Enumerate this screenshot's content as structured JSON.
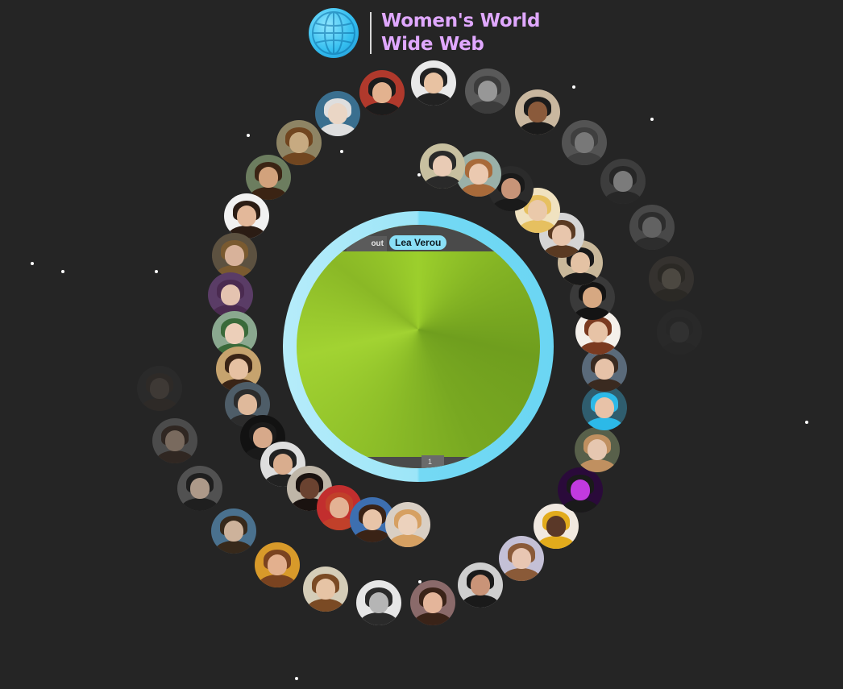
{
  "logo": {
    "title_line1": "Women's World",
    "title_line2": "Wide Web",
    "icon": "globe-icon",
    "colors": {
      "globe": "#35bff0",
      "title": "#e0a8ff"
    }
  },
  "featured": {
    "name": "Lea Verou",
    "preview_tab_text": "out",
    "preview_button_text": "1",
    "ring_color": "#8ae0f7",
    "preview_color": "#8fc029"
  },
  "background_color": "#252525"
}
